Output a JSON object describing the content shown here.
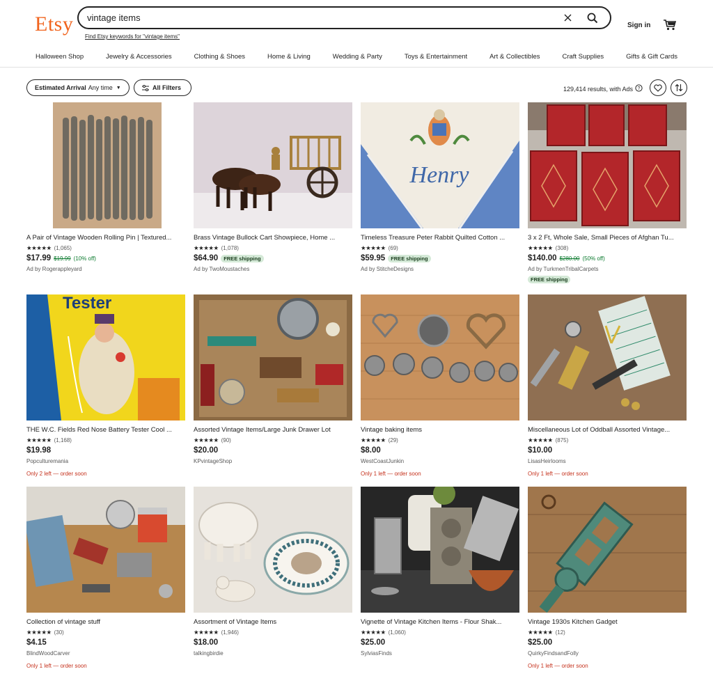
{
  "header": {
    "logo": "Etsy",
    "search_value": "vintage items",
    "keyword_link": "Find Etsy keywords for \"vintage items\"",
    "signin": "Sign in",
    "brand_color": "#f1641e"
  },
  "categories": [
    "Halloween Shop",
    "Jewelry & Accessories",
    "Clothing & Shoes",
    "Home & Living",
    "Wedding & Party",
    "Toys & Entertainment",
    "Art & Collectibles",
    "Craft Supplies",
    "Gifts & Gift Cards"
  ],
  "filters": {
    "arrival_label": "Estimated Arrival",
    "arrival_value": "Any time",
    "all_filters": "All Filters",
    "results": "129,414 results, with Ads"
  },
  "listings": [
    {
      "title": "A Pair of Vintage Wooden Rolling Pin | Textured...",
      "stars": "★★★★★",
      "reviews": "(1,065)",
      "price": "$17.99",
      "original": "$19.99",
      "discount": "(10% off)",
      "free_shipping": "",
      "shop": "Ad by Rogerappleyard",
      "stock": "",
      "image": "rolling-pins"
    },
    {
      "title": "Brass Vintage Bullock Cart Showpiece, Home ...",
      "stars": "★★★★★",
      "reviews": "(1,078)",
      "price": "$64.90",
      "original": "",
      "discount": "",
      "free_shipping": "FREE shipping",
      "shop": "Ad by TwoMoustaches",
      "stock": "",
      "image": "bullock-cart"
    },
    {
      "title": "Timeless Treasure Peter Rabbit Quilted Cotton ...",
      "stars": "★★★★★",
      "reviews": "(69)",
      "price": "$59.95",
      "original": "",
      "discount": "",
      "free_shipping": "FREE shipping",
      "shop": "Ad by StitcheDesigns",
      "stock": "",
      "image": "henry-quilt"
    },
    {
      "title": "3 x 2 Ft, Whole Sale, Small Pieces of Afghan Tu...",
      "stars": "★★★★★",
      "reviews": "(308)",
      "price": "$140.00",
      "original": "$280.00",
      "discount": "(50% off)",
      "free_shipping": "",
      "shop": "Ad by TurkmenTribalCarpets",
      "shipping_badge": "FREE shipping",
      "stock": "",
      "image": "rugs"
    },
    {
      "title": "THE W.C. Fields Red Nose Battery Tester Cool ...",
      "stars": "★★★★★",
      "reviews": "(1,168)",
      "price": "$19.98",
      "original": "",
      "discount": "",
      "free_shipping": "",
      "shop": "Popculturemania",
      "stock": "Only 2 left — order soon",
      "image": "battery-tester",
      "image_text": "Tester"
    },
    {
      "title": "Assorted Vintage Items/Large Junk Drawer Lot",
      "stars": "★★★★★",
      "reviews": "(90)",
      "price": "$20.00",
      "original": "",
      "discount": "",
      "free_shipping": "",
      "shop": "KPvintageShop",
      "stock": "",
      "image": "junk-drawer"
    },
    {
      "title": "Vintage baking items",
      "stars": "★★★★★",
      "reviews": "(29)",
      "price": "$8.00",
      "original": "",
      "discount": "",
      "free_shipping": "",
      "shop": "WestCoastJunkin",
      "stock": "Only 1 left — order soon",
      "image": "baking-tins"
    },
    {
      "title": "Miscellaneous Lot of Oddball Assorted Vintage...",
      "stars": "★★★★★",
      "reviews": "(875)",
      "price": "$10.00",
      "original": "",
      "discount": "",
      "free_shipping": "",
      "shop": "LisasHeirlooms",
      "stock": "Only 1 left — order soon",
      "image": "oddball-lot"
    },
    {
      "title": "Collection of vintage stuff",
      "stars": "★★★★★",
      "reviews": "(30)",
      "price": "$4.15",
      "original": "",
      "discount": "",
      "free_shipping": "",
      "shop": "BlindWoodCarver",
      "stock": "Only 1 left — order soon",
      "image": "vintage-stuff"
    },
    {
      "title": "Assortment of Vintage Items",
      "stars": "★★★★★",
      "reviews": "(1,946)",
      "price": "$18.00",
      "original": "",
      "discount": "",
      "free_shipping": "",
      "shop": "talkingbirdie",
      "stock": "",
      "image": "ceramics"
    },
    {
      "title": "Vignette of Vintage Kitchen Items - Flour Shak...",
      "stars": "★★★★★",
      "reviews": "(1,060)",
      "price": "$25.00",
      "original": "",
      "discount": "",
      "free_shipping": "",
      "shop": "SylviasFinds",
      "stock": "",
      "image": "kitchen-items"
    },
    {
      "title": "Vintage 1930s Kitchen Gadget",
      "stars": "★★★★★",
      "reviews": "(12)",
      "price": "$25.00",
      "original": "",
      "discount": "",
      "free_shipping": "",
      "shop": "QuirkyFindsandFolly",
      "stock": "Only 1 left — order soon",
      "image": "kitchen-gadget"
    }
  ]
}
